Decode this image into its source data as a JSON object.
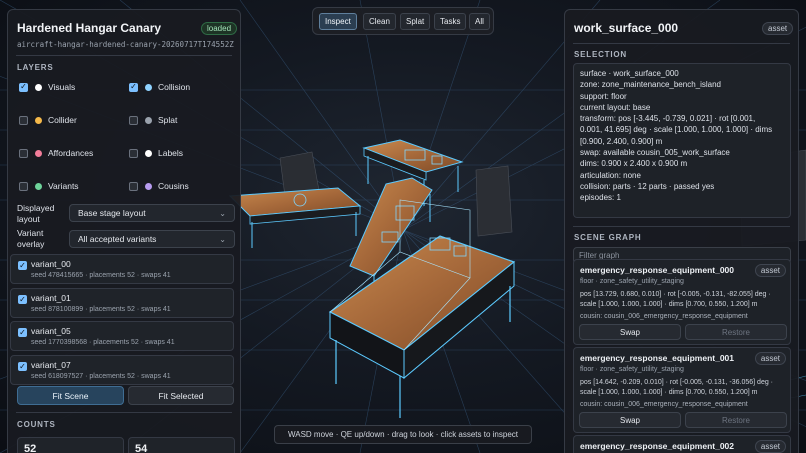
{
  "toolbar": {
    "buttons": [
      {
        "label": "Inspect",
        "active": true
      },
      {
        "label": "Clean",
        "active": false
      },
      {
        "label": "Splat",
        "active": false
      },
      {
        "label": "Tasks",
        "active": false
      },
      {
        "label": "All",
        "active": false
      }
    ]
  },
  "left": {
    "title": "Hardened Hangar Canary",
    "status": "loaded",
    "run_id": "aircraft-hangar-hardened-canary-20260717T174552Z",
    "layers_heading": "LAYERS",
    "layers": [
      {
        "label": "Visuals",
        "checked": true,
        "color": "#ffffff"
      },
      {
        "label": "Collision",
        "checked": true,
        "color": "#8fd3ff"
      },
      {
        "label": "Collider",
        "checked": false,
        "color": "#f5b94a"
      },
      {
        "label": "Splat",
        "checked": false,
        "color": "#9aa2ad"
      },
      {
        "label": "Affordances",
        "checked": false,
        "color": "#f27d9a"
      },
      {
        "label": "Labels",
        "checked": false,
        "color": "#ffffff"
      },
      {
        "label": "Variants",
        "checked": false,
        "color": "#6ed39a"
      },
      {
        "label": "Cousins",
        "checked": false,
        "color": "#b79cf0"
      }
    ],
    "displayed_layout_label": "Displayed layout",
    "displayed_layout_value": "Base stage layout",
    "variant_overlay_label": "Variant overlay",
    "variant_overlay_value": "All accepted variants",
    "variants": [
      {
        "name": "variant_00",
        "meta": "seed 478415665 · placements 52 · swaps 41"
      },
      {
        "name": "variant_01",
        "meta": "seed 878100899 · placements 52 · swaps 41"
      },
      {
        "name": "variant_05",
        "meta": "seed 1770398568 · placements 52 · swaps 41"
      },
      {
        "name": "variant_07",
        "meta": "seed 618097527 · placements 52 · swaps 41"
      }
    ],
    "fit_scene": "Fit Scene",
    "fit_selected": "Fit Selected",
    "counts_heading": "COUNTS",
    "counts": [
      "52",
      "54"
    ]
  },
  "hint": "WASD move · QE up/down · drag to look · click assets to inspect",
  "right": {
    "title": "work_surface_000",
    "badge": "asset",
    "selection_heading": "SELECTION",
    "selection_lines": [
      "surface · work_surface_000",
      "zone: zone_maintenance_bench_island",
      "support: floor",
      "current layout: base",
      "transform: pos [-3.445, -0.739, 0.021] · rot [0.001,",
      "0.001, 41.695] deg · scale [1.000, 1.000, 1.000] · dims",
      "[0.900, 2.400, 0.900] m",
      "swap: available cousin_005_work_surface",
      "dims: 0.900 x 2.400 x 0.900 m",
      "articulation: none",
      "collision: parts · 12 parts · passed yes",
      "episodes: 1"
    ],
    "graph_heading": "SCENE GRAPH",
    "filter_placeholder": "Filter graph",
    "graph_items": [
      {
        "name": "emergency_response_equipment_000",
        "badge": "asset",
        "sub": "floor · zone_safety_utility_staging",
        "transform": "pos [13.729, 0.680, 0.010] · rot [-0.005, -0.131, -82.055] deg · scale [1.000, 1.000, 1.000] · dims [0.700, 0.550, 1.200] m",
        "cousin": "cousin: cousin_006_emergency_response_equipment",
        "swap": "Swap",
        "restore": "Restore"
      },
      {
        "name": "emergency_response_equipment_001",
        "badge": "asset",
        "sub": "floor · zone_safety_utility_staging",
        "transform": "pos [14.642, -0.209, 0.010] · rot [-0.005, -0.131, -36.056] deg · scale [1.000, 1.000, 1.000] · dims [0.700, 0.550, 1.200] m",
        "cousin": "cousin: cousin_006_emergency_response_equipment",
        "swap": "Swap",
        "restore": "Restore"
      },
      {
        "name": "emergency_response_equipment_002",
        "badge": "asset"
      }
    ]
  }
}
